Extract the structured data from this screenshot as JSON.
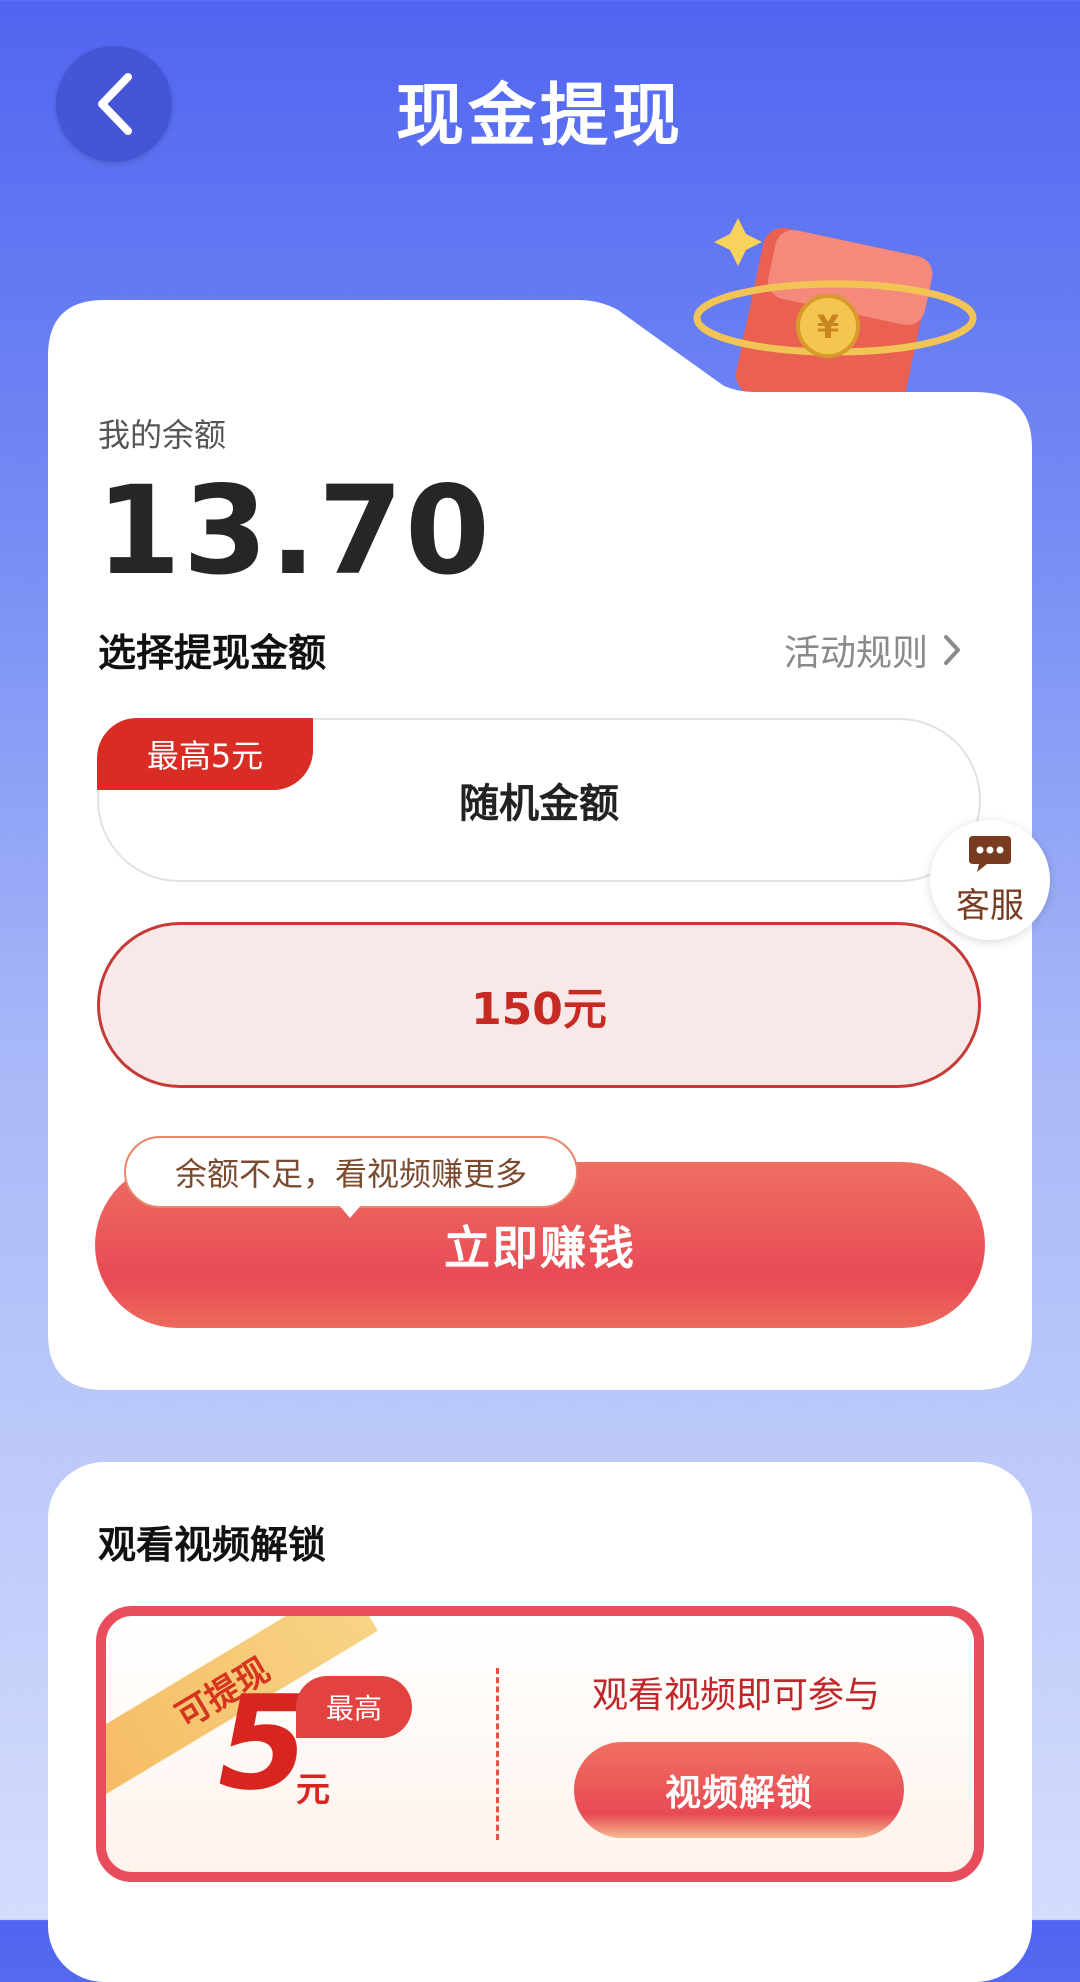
{
  "header": {
    "title": "现金提现",
    "back_icon": "chevron-left-icon"
  },
  "balance": {
    "label": "我的余额",
    "value": "13.70"
  },
  "withdraw": {
    "section_title": "选择提现金额",
    "rules_label": "活动规则",
    "options": [
      {
        "label": "随机金额",
        "tag": "最高5元",
        "selected": false
      },
      {
        "label": "150元",
        "selected": true
      }
    ]
  },
  "earn": {
    "button_label": "立即赚钱",
    "tooltip": "余额不足，看视频赚更多"
  },
  "customer_service": {
    "label": "客服",
    "icon": "chat-bubble-icon"
  },
  "unlock": {
    "section_title": "观看视频解锁",
    "ribbon": "可提现",
    "amount": "5",
    "unit": "元",
    "max_tag": "最高",
    "description": "观看视频即可参与",
    "button_label": "视频解锁"
  },
  "colors": {
    "accent_red": "#e84a55",
    "header_blue": "#5065f0"
  }
}
